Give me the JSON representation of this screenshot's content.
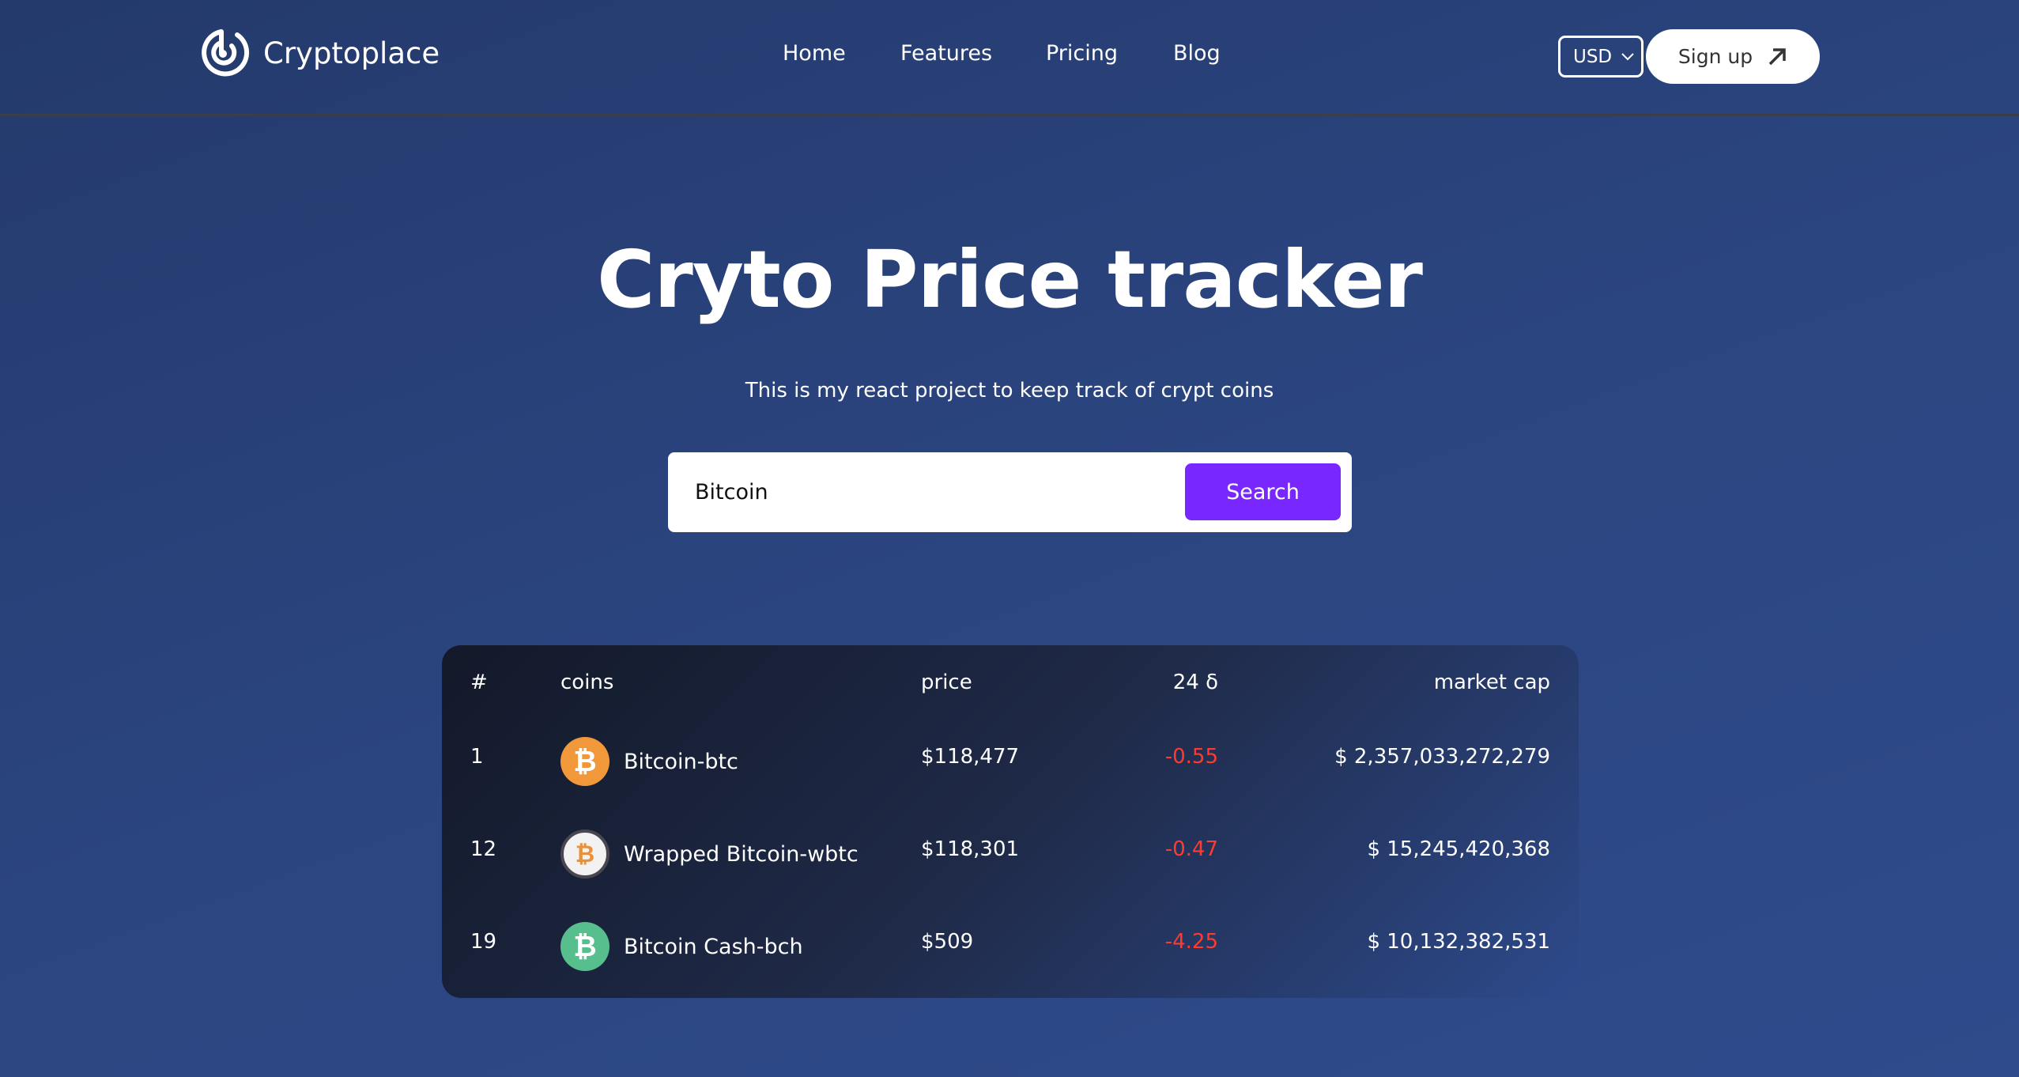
{
  "nav": {
    "brand": "Cryptoplace",
    "links": [
      "Home",
      "Features",
      "Pricing",
      "Blog"
    ],
    "currency": "USD",
    "signup": "Sign up"
  },
  "hero": {
    "title": "Cryto Price tracker",
    "subtitle": "This is my react project to keep track of crypt coins"
  },
  "search": {
    "value": "Bitcoin",
    "button": "Search"
  },
  "table": {
    "headers": {
      "rank": "#",
      "coins": "coins",
      "price": "price",
      "change": "24 δ",
      "market_cap": "market cap"
    },
    "rows": [
      {
        "rank": "1",
        "name": "Bitcoin-btc",
        "price": "$118,477",
        "change": "-0.55",
        "market_cap": "$ 2,357,033,272,279",
        "icon_color": "#f0983a"
      },
      {
        "rank": "12",
        "name": "Wrapped Bitcoin-wbtc",
        "price": "$118,301",
        "change": "-0.47",
        "market_cap": "$ 15,245,420,368",
        "icon_color": "#f2f2f2"
      },
      {
        "rank": "19",
        "name": "Bitcoin Cash-bch",
        "price": "$509",
        "change": "-4.25",
        "market_cap": "$ 10,132,382,531",
        "icon_color": "#57bf8e"
      }
    ]
  },
  "colors": {
    "accent": "#7927ff",
    "negative": "#ff3b2f"
  }
}
